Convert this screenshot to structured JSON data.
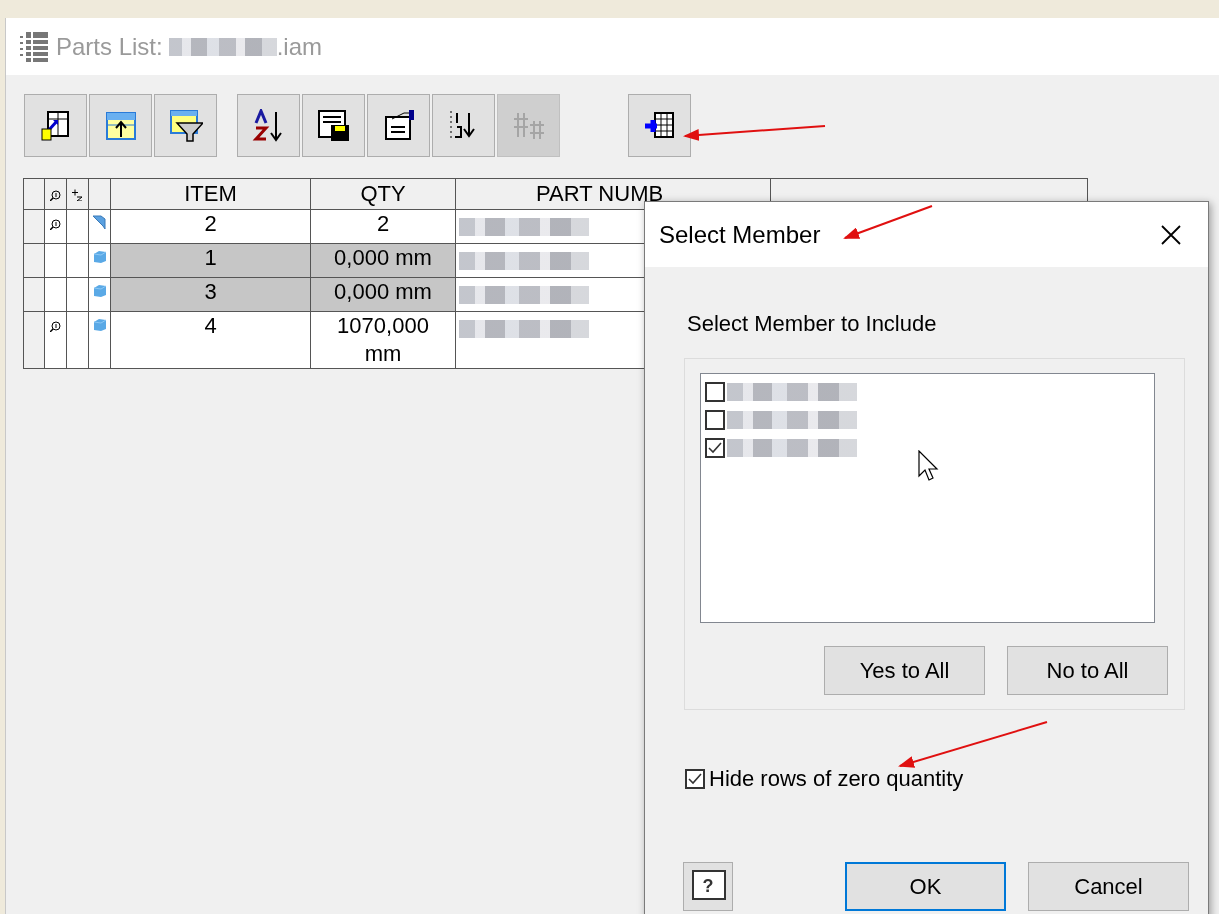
{
  "window": {
    "title_prefix": "Parts List:",
    "title_suffix": ".iam"
  },
  "toolbar": [
    {
      "disabled": false
    },
    {
      "disabled": false
    },
    {
      "disabled": false
    },
    {
      "disabled": false
    },
    {
      "disabled": false
    },
    {
      "disabled": false
    },
    {
      "disabled": false
    },
    {
      "disabled": true
    },
    {
      "disabled": false
    }
  ],
  "table": {
    "columns": [
      "ITEM",
      "QTY",
      "PART NUMB"
    ],
    "rows": [
      {
        "magnifier": true,
        "kind": "sheet",
        "item": "2",
        "qty": "2",
        "highlighted": false
      },
      {
        "magnifier": false,
        "kind": "part",
        "item": "1",
        "qty": "0,000 mm",
        "highlighted": true
      },
      {
        "magnifier": false,
        "kind": "part",
        "item": "3",
        "qty": "0,000 mm",
        "highlighted": true
      },
      {
        "magnifier": true,
        "kind": "part",
        "item": "4",
        "qty": "1070,000\nmm",
        "highlighted": false
      }
    ]
  },
  "dialog": {
    "title": "Select Member",
    "prompt": "Select Member to Include",
    "members": [
      {
        "checked": false
      },
      {
        "checked": false
      },
      {
        "checked": true
      }
    ],
    "yes_to_all": "Yes to All",
    "no_to_all": "No to All",
    "hide_zero": {
      "label": "Hide rows of zero quantity",
      "checked": true
    },
    "help": "?",
    "ok": "OK",
    "cancel": "Cancel"
  }
}
